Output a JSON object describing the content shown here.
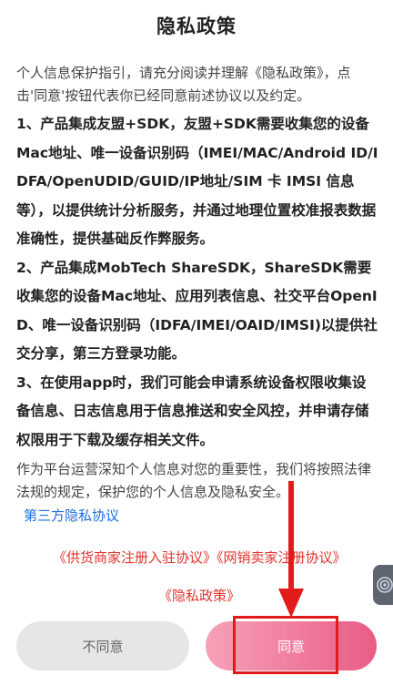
{
  "dialog": {
    "title": "隐私政策",
    "intro": "个人信息保护指引，请充分阅读并理解《隐私政策》，点击'同意'按钮代表你已经同意前述协议以及约定。",
    "points": [
      "1、产品集成友盟+SDK，友盟+SDK需要收集您的设备Mac地址、唯一设备识别码（IMEI/MAC/Android ID/IDFA/OpenUDID/GUID/IP地址/SIM 卡 IMSI 信息等），以提供统计分析服务，并通过地理位置校准报表数据准确性，提供基础反作弊服务。",
      "2、产品集成MobTech ShareSDK，ShareSDK需要收集您的设备Mac地址、应用列表信息、社交平台OpenID、唯一设备识别码（IDFA/IMEI/OAID/IMSI)以提供社交分享，第三方登录功能。",
      "3、在使用app时，我们可能会申请系统设备权限收集设备信息、日志信息用于信息推送和安全风控，并申请存储权限用于下载及缓存相关文件。"
    ],
    "closing": "作为平台运营深知个人信息对您的重要性，我们将按照法律法规的规定，保护您的个人信息及隐私安全。",
    "third_party_link": "第三方隐私协议",
    "agreements": {
      "supplier": "《供货商家注册入驻协议》",
      "seller": "《网销卖家注册协议》",
      "privacy": "《隐私政策》"
    },
    "buttons": {
      "disagree": "不同意",
      "agree": "同意"
    }
  },
  "colors": {
    "accent": "#e95c86",
    "link": "#1e6fe0",
    "agreement": "#e0342c",
    "annotation": "#e11b1b"
  }
}
